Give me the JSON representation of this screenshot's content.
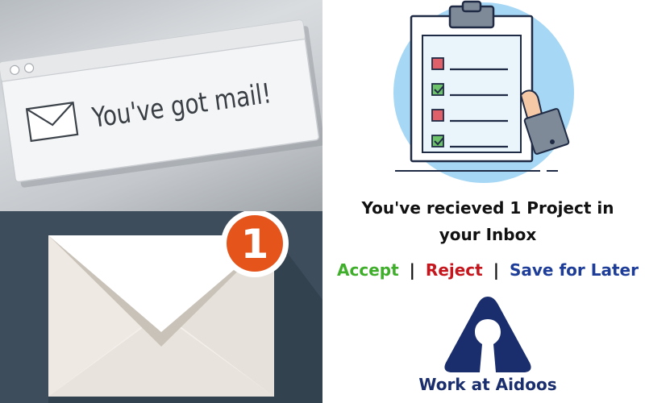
{
  "mail_window": {
    "message": "You've got mail!"
  },
  "notification": {
    "badge_count": "1",
    "badge_color": "#e4541b"
  },
  "headline": {
    "line1": "You've recieved 1 Project in",
    "line2": "your Inbox"
  },
  "actions": {
    "accept": "Accept",
    "reject": "Reject",
    "save_for_later": "Save for Later",
    "separator": "|",
    "accept_color": "#3fae2a",
    "reject_color": "#c4161c",
    "save_color": "#1d3d99"
  },
  "brand": {
    "name": "Work at Aidoos",
    "color": "#1a2e6e"
  }
}
